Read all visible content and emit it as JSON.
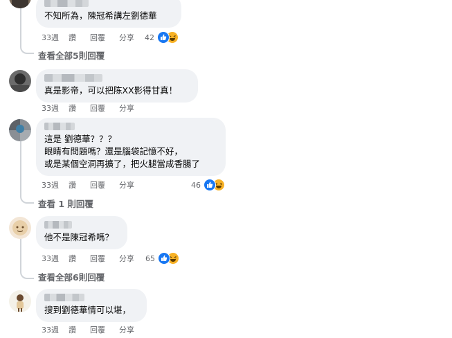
{
  "comments": [
    {
      "text": "不知所為，陳冠希講左劉德華",
      "age": "33週",
      "like": "讚",
      "reply": "回覆",
      "share": "分享",
      "reaction_count": "42",
      "reactions": [
        "like-icon",
        "haha-icon"
      ],
      "view_replies": "查看全部5則回覆"
    },
    {
      "text": "真是影帝，可以把陈XX影得甘真！",
      "age": "33週",
      "like": "讚",
      "reply": "回覆",
      "share": "分享"
    },
    {
      "text": "這是 劉德華？？？\n眼睛有問題嗎？還是腦袋記憶不好，\n或是某個空洞再擴了，把火腿當成香腸了",
      "age": "33週",
      "like": "讚",
      "reply": "回覆",
      "share": "分享",
      "reaction_count": "46",
      "reactions": [
        "like-icon",
        "haha-icon"
      ],
      "view_replies": "查看 1 則回覆"
    },
    {
      "text": "他不是陳冠希嗎？",
      "age": "33週",
      "like": "讚",
      "reply": "回覆",
      "share": "分享",
      "reaction_count": "65",
      "reactions": [
        "like-icon",
        "haha-icon"
      ],
      "view_replies": "查看全部6則回覆"
    },
    {
      "text": "搜到劉德華情可以堪，",
      "age": "33週",
      "like": "讚",
      "reply": "回覆",
      "share": "分享"
    }
  ],
  "colors": {
    "bubble": "#f0f2f5",
    "meta": "#65676b",
    "like": "#1877f2",
    "haha": "#f7b125"
  }
}
